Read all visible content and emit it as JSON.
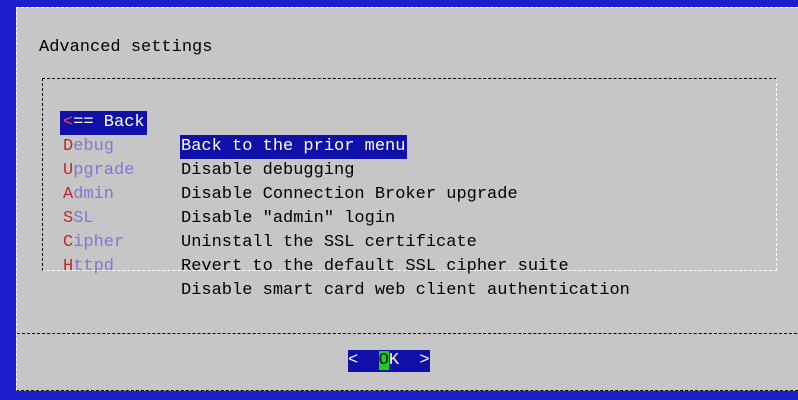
{
  "dialog": {
    "title": "Advanced settings"
  },
  "menu": {
    "items": [
      {
        "tag_first": "<",
        "tag_rest": "== Back",
        "description": "Back to the prior menu",
        "selected": true
      },
      {
        "tag_first": "D",
        "tag_rest": "ebug",
        "description": "Disable debugging"
      },
      {
        "tag_first": "U",
        "tag_rest": "pgrade",
        "description": "Disable Connection Broker upgrade"
      },
      {
        "tag_first": "A",
        "tag_rest": "dmin",
        "description": "Disable \"admin\" login"
      },
      {
        "tag_first": "S",
        "tag_rest": "SL",
        "description": "Uninstall the SSL certificate"
      },
      {
        "tag_first": "C",
        "tag_rest": "ipher",
        "description": "Revert to the default SSL cipher suite"
      },
      {
        "tag_first": "H",
        "tag_rest": "ttpd",
        "description": "Disable smart card web client authentication"
      }
    ]
  },
  "buttons": {
    "ok": {
      "left_bracket": "<  ",
      "hot": "O",
      "rest": "K  >"
    }
  },
  "colors": {
    "background": "#1e1ecf",
    "dialog": "#c6c6c6",
    "selection": "#1010a8",
    "hotkey": "#c0282c",
    "tag": "#7c78d6",
    "ok_hotkey": "#17d11b"
  }
}
